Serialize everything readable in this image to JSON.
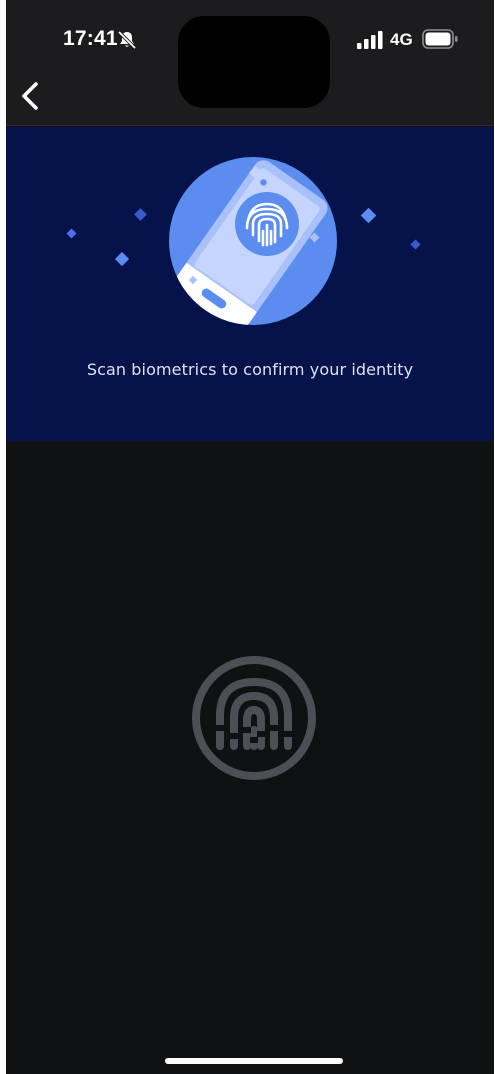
{
  "status_bar": {
    "time": "17:41",
    "network": "4G",
    "icons": [
      "bell-slash-icon",
      "signal-icon",
      "battery-icon"
    ]
  },
  "nav": {
    "back_icon": "chevron-left-icon"
  },
  "hero": {
    "illustration": "phone-fingerprint-illustration",
    "message": "Scan biometrics to confirm your identity"
  },
  "scan": {
    "icon": "fingerprint-icon"
  },
  "colors": {
    "hero_background": "#06124a",
    "accent": "#5b8def",
    "page_background": "#101113",
    "fingerprint": "#4d4f55"
  }
}
